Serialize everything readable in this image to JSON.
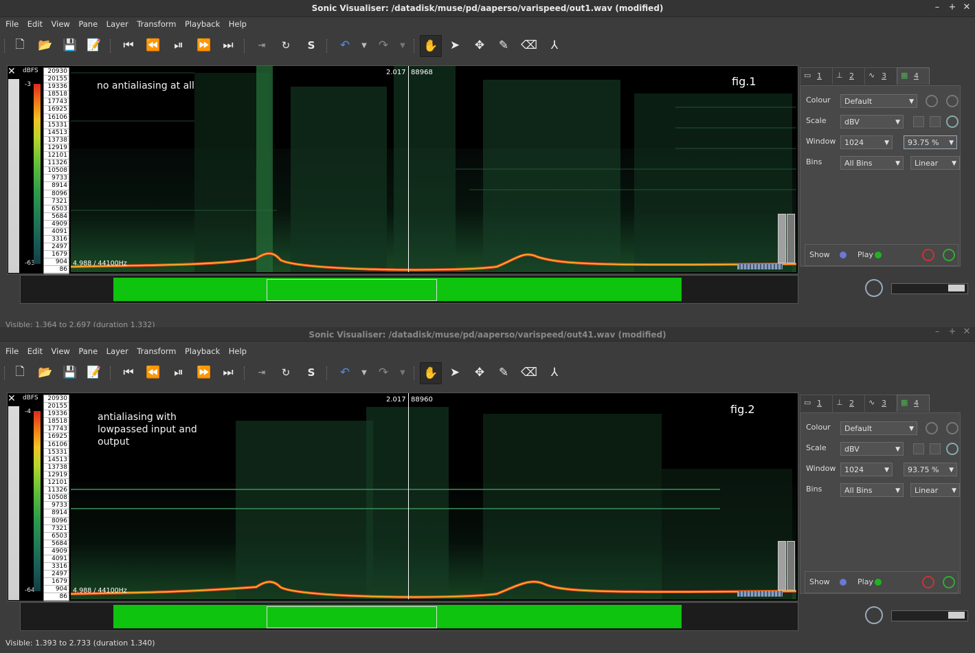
{
  "windows": [
    {
      "title": "Sonic Visualiser: /datadisk/muse/pd/aaperso/varispeed/out1.wav (modified)",
      "menu": [
        "File",
        "Edit",
        "View",
        "Pane",
        "Layer",
        "Transform",
        "Playback",
        "Help"
      ],
      "db_unit": "dBFS",
      "db_top": "-3",
      "db_bottom": "-63",
      "freq_labels": [
        "20930",
        "20155",
        "19336",
        "18518",
        "17743",
        "16925",
        "16106",
        "15331",
        "14513",
        "13738",
        "12919",
        "12101",
        "11326",
        "10508",
        "9733",
        "8914",
        "8096",
        "7321",
        "6503",
        "5684",
        "4909",
        "4091",
        "3316",
        "2497",
        "1679",
        "904",
        "86"
      ],
      "cursor_time": "2.017",
      "cursor_frame": "88968",
      "annotation": "no antialiasing at all",
      "fig_label": "fig.1",
      "sample_rate_label": "4.988 / 44100Hz",
      "status": "Visible: 1.364 to 2.697 (duration 1.332)",
      "tabs": [
        {
          "num": "1",
          "icon": "waveform-layer-icon"
        },
        {
          "num": "2",
          "icon": "ruler-layer-icon"
        },
        {
          "num": "3",
          "icon": "waveform-layer-icon"
        },
        {
          "num": "4",
          "icon": "spectrogram-layer-icon"
        }
      ],
      "props": {
        "colour_label": "Colour",
        "colour_value": "Default",
        "scale_label": "Scale",
        "scale_value": "dBV",
        "window_label": "Window",
        "window_value": "1024",
        "overlap_value": "93.75 %",
        "bins_label": "Bins",
        "bins_value": "All Bins",
        "bins_scale": "Linear",
        "show_label": "Show",
        "play_label": "Play"
      }
    },
    {
      "title": "Sonic Visualiser: /datadisk/muse/pd/aaperso/varispeed/out41.wav (modified)",
      "menu": [
        "File",
        "Edit",
        "View",
        "Pane",
        "Layer",
        "Transform",
        "Playback",
        "Help"
      ],
      "db_unit": "dBFS",
      "db_top": "-4",
      "db_bottom": "-64",
      "freq_labels": [
        "20930",
        "20155",
        "19336",
        "18518",
        "17743",
        "16925",
        "16106",
        "15331",
        "14513",
        "13738",
        "12919",
        "12101",
        "11326",
        "10508",
        "9733",
        "8914",
        "8096",
        "7321",
        "6503",
        "5684",
        "4909",
        "4091",
        "3316",
        "2497",
        "1679",
        "904",
        "86"
      ],
      "cursor_time": "2.017",
      "cursor_frame": "88960",
      "annotation_lines": [
        "antialiasing with",
        "lowpassed input and",
        "output"
      ],
      "fig_label": "fig.2",
      "sample_rate_label": "4.988 / 44100Hz",
      "status": "Visible: 1.393 to 2.733 (duration 1.340)",
      "tabs": [
        {
          "num": "1",
          "icon": "waveform-layer-icon"
        },
        {
          "num": "2",
          "icon": "ruler-layer-icon"
        },
        {
          "num": "3",
          "icon": "waveform-layer-icon"
        },
        {
          "num": "4",
          "icon": "spectrogram-layer-icon"
        }
      ],
      "props": {
        "colour_label": "Colour",
        "colour_value": "Default",
        "scale_label": "Scale",
        "scale_value": "dBV",
        "window_label": "Window",
        "window_value": "1024",
        "overlap_value": "93.75 %",
        "bins_label": "Bins",
        "bins_value": "All Bins",
        "bins_scale": "Linear",
        "show_label": "Show",
        "play_label": "Play"
      }
    }
  ],
  "colors": {
    "spectro_green": "#2f8a4e",
    "energy_red": "#e8461c",
    "overview_green": "#0ec40e",
    "led_green": "#1fb41f",
    "led_blue": "#6a78d8"
  }
}
